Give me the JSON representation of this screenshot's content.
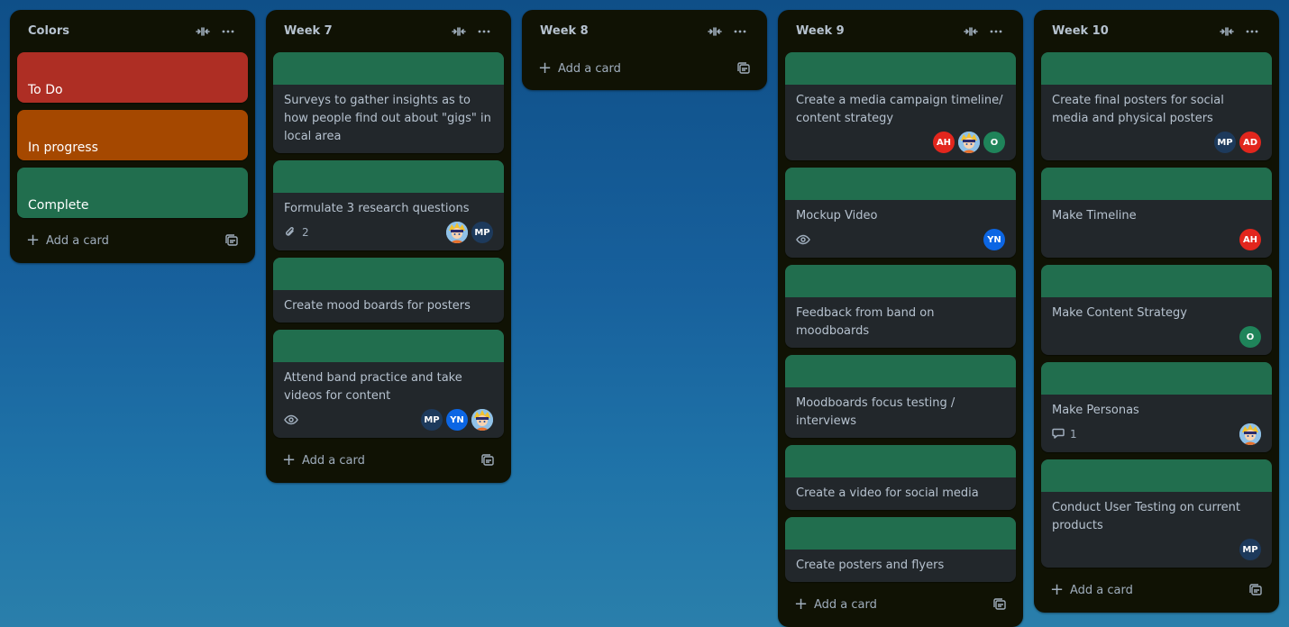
{
  "colors": {
    "list_bg": "#101204",
    "card_bg": "#22272b",
    "cover_green": "#216e4e",
    "todo": "#ae2e24",
    "in_progress": "#a54800",
    "complete": "#216e4e"
  },
  "add_card_label": "Add a card",
  "lists": [
    {
      "title": "Colors",
      "color_cards": [
        {
          "label": "To Do",
          "color": "#ae2e24"
        },
        {
          "label": "In progress",
          "color": "#a54800"
        },
        {
          "label": "Complete",
          "color": "#216e4e"
        }
      ]
    },
    {
      "title": "Week 7",
      "cards": [
        {
          "title": "Surveys to gather insights as to how people find out about \"gigs\" in local area"
        },
        {
          "title": "Formulate 3 research questions",
          "attachments": "2",
          "members": [
            "img",
            "MP"
          ]
        },
        {
          "title": "Create mood boards for posters"
        },
        {
          "title": "Attend band practice and take videos for content",
          "watch": true,
          "members": [
            "MP",
            "YN",
            "img"
          ]
        }
      ]
    },
    {
      "title": "Week 8",
      "cards": []
    },
    {
      "title": "Week 9",
      "cards": [
        {
          "title": "Create a media campaign timeline/ content strategy",
          "members": [
            "AH",
            "img",
            "O"
          ]
        },
        {
          "title": "Mockup Video",
          "watch": true,
          "members": [
            "YN"
          ]
        },
        {
          "title": "Feedback from band on moodboards"
        },
        {
          "title": "Moodboards focus testing / interviews"
        },
        {
          "title": "Create a video for social media"
        },
        {
          "title": "Create posters and flyers"
        }
      ]
    },
    {
      "title": "Week 10",
      "cards": [
        {
          "title": "Create final posters for social media and physical posters",
          "members": [
            "MP",
            "AD"
          ]
        },
        {
          "title": "Make Timeline",
          "members": [
            "AH"
          ]
        },
        {
          "title": "Make Content Strategy",
          "members": [
            "O"
          ]
        },
        {
          "title": "Make Personas",
          "comments": "1",
          "members": [
            "img"
          ]
        },
        {
          "title": "Conduct User Testing on current products",
          "members": [
            "MP"
          ]
        }
      ]
    }
  ],
  "avatar_colors": {
    "MP": "#1d3a5c",
    "YN": "#0c66e4",
    "AH": "#e2261d",
    "AD": "#e2261d",
    "O": "#1f845a"
  },
  "icons": {
    "collapse": "collapse-icon",
    "more": "more-icon",
    "plus": "plus-icon",
    "template": "template-icon",
    "attachment": "paperclip-icon",
    "watch": "eye-icon",
    "comment": "comment-icon"
  }
}
